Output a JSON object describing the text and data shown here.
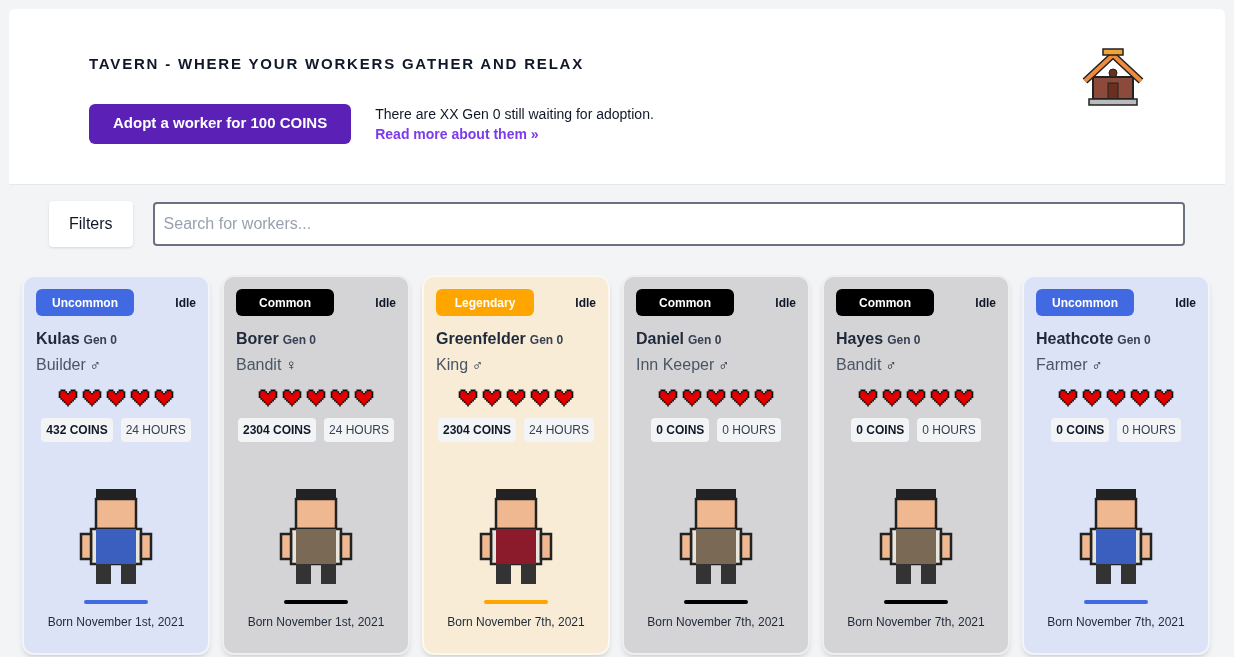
{
  "header": {
    "title": "TAVERN - WHERE YOUR WORKERS GATHER AND RELAX",
    "adopt_button": "Adopt a worker for 100 COINS",
    "info": "There are XX Gen 0 still waiting for adoption.",
    "link": "Read more about them »"
  },
  "filters": {
    "button": "Filters",
    "search": {
      "placeholder": "Search for workers..."
    }
  },
  "workers": [
    {
      "kind": "uncommon",
      "rarity": "Uncommon",
      "status": "Idle",
      "name": "Kulas",
      "gen": "Gen 0",
      "job": "Builder",
      "gender": "♂",
      "stars": 5,
      "coins": "432 COINS",
      "hours": "24 HOURS",
      "born": "Born November 1st, 2021"
    },
    {
      "kind": "common",
      "rarity": "Common",
      "status": "Idle",
      "name": "Borer",
      "gen": "Gen 0",
      "job": "Bandit",
      "gender": "♀",
      "stars": 5,
      "coins": "2304 COINS",
      "hours": "24 HOURS",
      "born": "Born November 1st, 2021"
    },
    {
      "kind": "legendary",
      "rarity": "Legendary",
      "status": "Idle",
      "name": "Greenfelder",
      "gen": "Gen 0",
      "job": "King",
      "gender": "♂",
      "stars": 5,
      "coins": "2304 COINS",
      "hours": "24 HOURS",
      "born": "Born November 7th, 2021"
    },
    {
      "kind": "common",
      "rarity": "Common",
      "status": "Idle",
      "name": "Daniel",
      "gen": "Gen 0",
      "job": "Inn Keeper",
      "gender": "♂",
      "stars": 5,
      "coins": "0 COINS",
      "hours": "0 HOURS",
      "born": "Born November 7th, 2021"
    },
    {
      "kind": "common",
      "rarity": "Common",
      "status": "Idle",
      "name": "Hayes",
      "gen": "Gen 0",
      "job": "Bandit",
      "gender": "♂",
      "stars": 5,
      "coins": "0 COINS",
      "hours": "0 HOURS",
      "born": "Born November 7th, 2021"
    },
    {
      "kind": "uncommon",
      "rarity": "Uncommon",
      "status": "Idle",
      "name": "Heathcote",
      "gen": "Gen 0",
      "job": "Farmer",
      "gender": "♂",
      "stars": 5,
      "coins": "0 COINS",
      "hours": "0 HOURS",
      "born": "Born November 7th, 2021"
    }
  ]
}
